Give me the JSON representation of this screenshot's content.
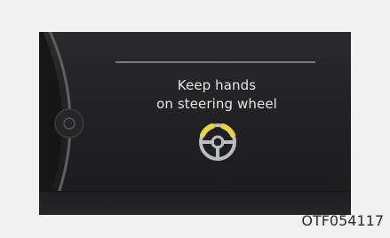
{
  "display": {
    "message": {
      "line1": "Keep hands",
      "line2": "on steering wheel"
    },
    "icon": "steering-wheel-icon"
  },
  "caption": {
    "code": "OTF054117"
  },
  "colors": {
    "panel_background": "#222224",
    "text": "#e6e6e6",
    "wheel": "#b9bcc0",
    "hands_highlight": "#e9d34b",
    "page_background": "#f1f1f1"
  }
}
